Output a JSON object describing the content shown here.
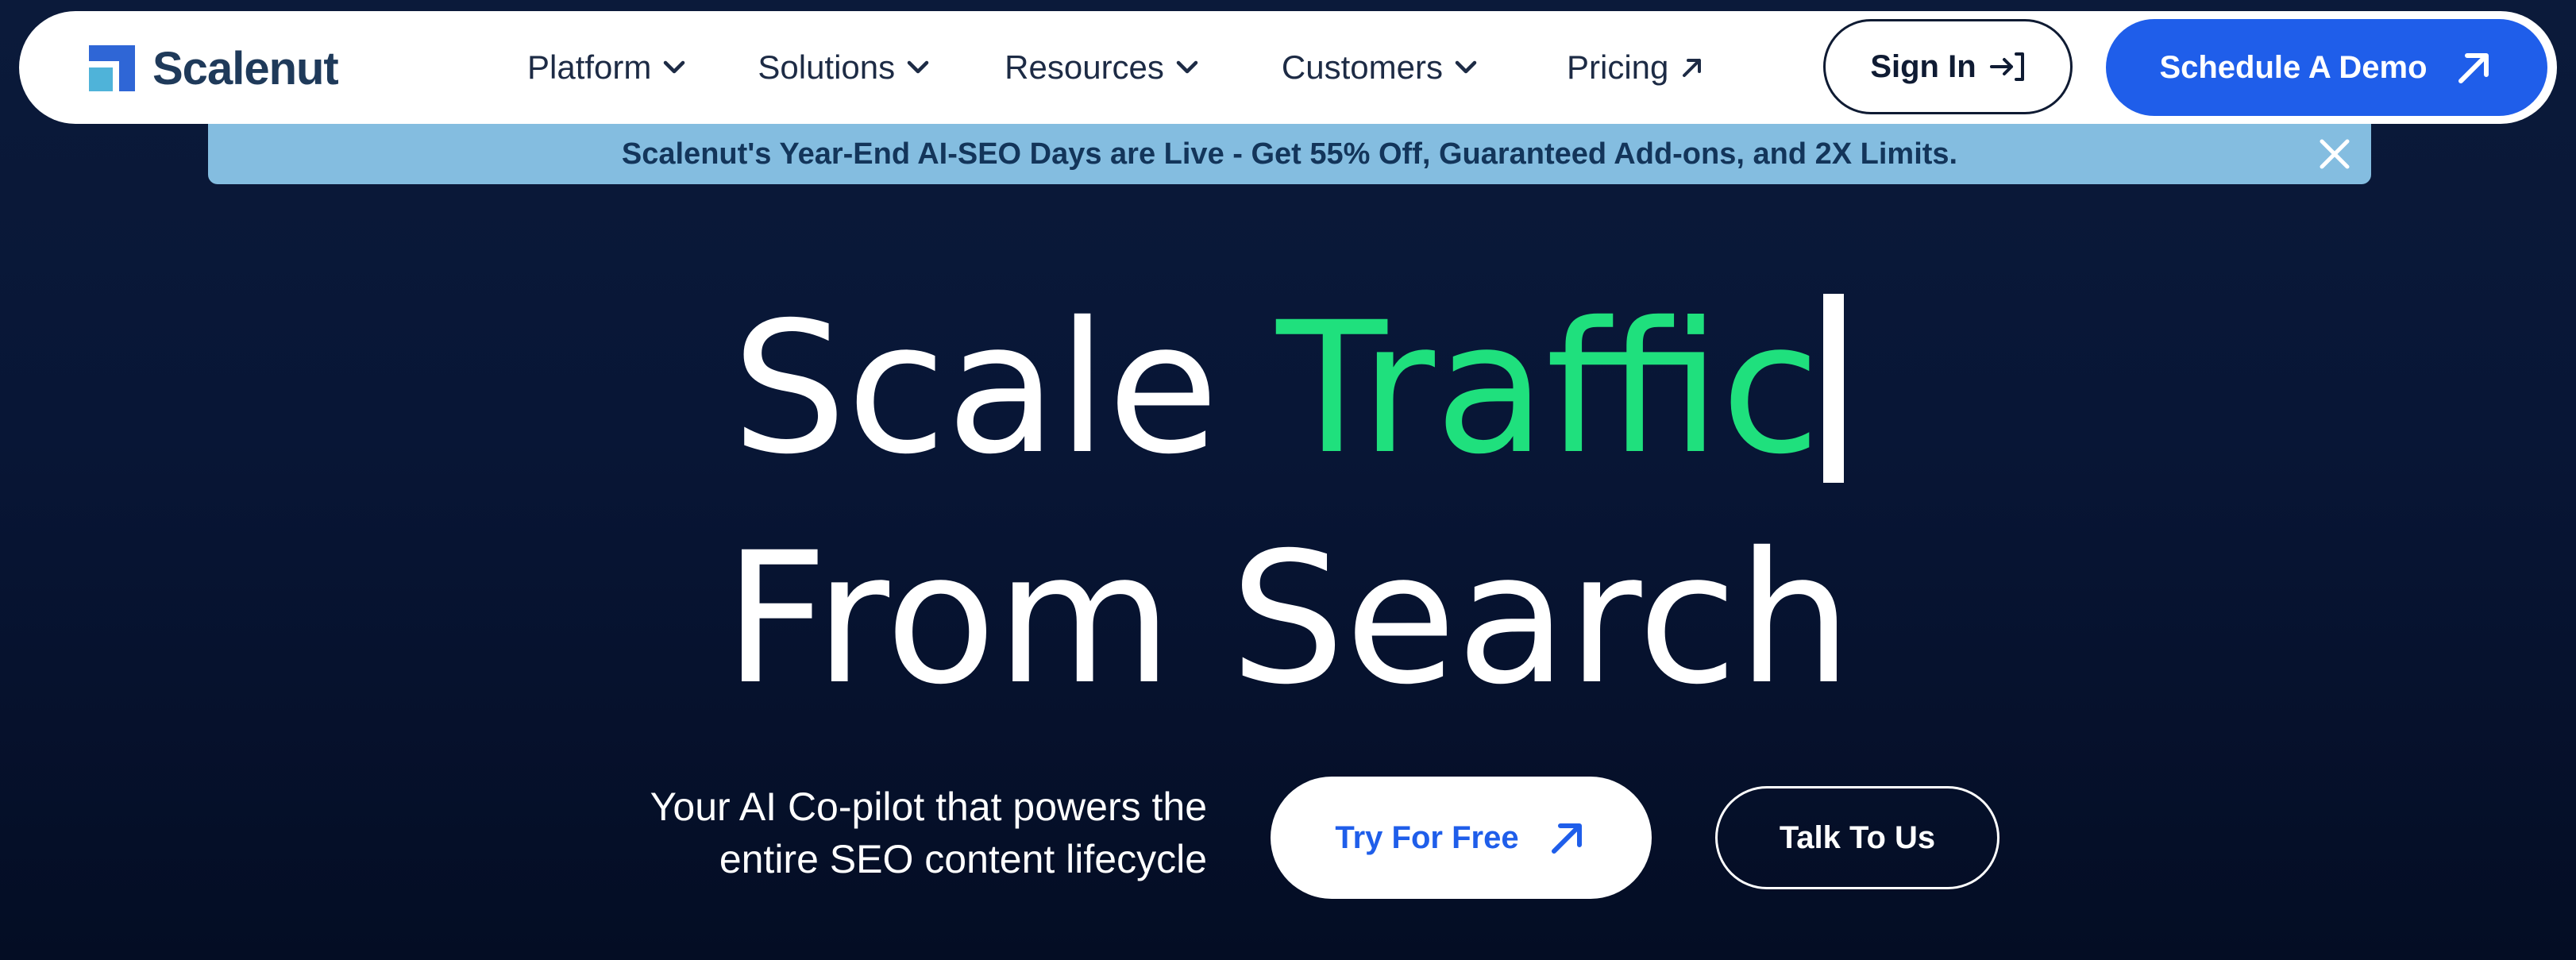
{
  "brand": {
    "name": "Scalenut",
    "colors": {
      "primary_blue": "#1f5eea",
      "accent_green": "#1fe07d",
      "navy_background": "#081636",
      "banner_blue": "#84bde0"
    }
  },
  "nav": {
    "items": [
      {
        "label": "Platform",
        "icon": "chevron-down-icon"
      },
      {
        "label": "Solutions",
        "icon": "chevron-down-icon"
      },
      {
        "label": "Resources",
        "icon": "chevron-down-icon"
      },
      {
        "label": "Customers",
        "icon": "chevron-down-icon"
      },
      {
        "label": "Pricing",
        "icon": "arrow-up-right-icon"
      }
    ],
    "sign_in": {
      "label": "Sign In",
      "icon": "sign-in-arrow-icon"
    },
    "demo": {
      "label": "Schedule A Demo",
      "icon": "arrow-up-right-icon"
    }
  },
  "banner": {
    "text": "Scalenut's Year-End AI-SEO Days are Live - Get 55% Off, Guaranteed Add-ons, and 2X Limits.",
    "close_icon": "close-icon"
  },
  "hero": {
    "headline_prefix": "Scale",
    "headline_rotating_word": "Traffic",
    "headline_line2": "From Search",
    "tagline_line1": "Your AI Co-pilot that powers the",
    "tagline_line2": "entire SEO content lifecycle",
    "cta_primary": {
      "label": "Try For Free",
      "icon": "arrow-up-right-icon"
    },
    "cta_secondary": {
      "label": "Talk To Us"
    }
  }
}
